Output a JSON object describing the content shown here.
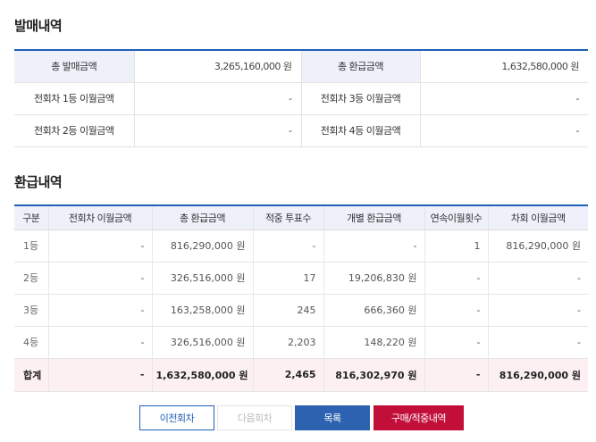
{
  "sales_section": {
    "title": "발매내역",
    "rows": [
      {
        "label1": "총 발매금액",
        "value1": "3,265,160,000 원",
        "label2": "총 환급금액",
        "value2": "1,632,580,000 원"
      },
      {
        "label1": "전회차 1등 이월금액",
        "value1": "-",
        "label2": "전회차 3등 이월금액",
        "value2": "-"
      },
      {
        "label1": "전회차 2등 이월금액",
        "value1": "-",
        "label2": "전회차 4등 이월금액",
        "value2": "-"
      }
    ]
  },
  "refund_section": {
    "title": "환급내역",
    "headers": [
      "구분",
      "전회차 이월금액",
      "총 환급금액",
      "적중 투표수",
      "개별 환급금액",
      "연속이월횟수",
      "차회 이월금액"
    ],
    "rows": [
      [
        "1등",
        "-",
        "816,290,000 원",
        "-",
        "-",
        "1",
        "816,290,000 원"
      ],
      [
        "2등",
        "-",
        "326,516,000 원",
        "17",
        "19,206,830 원",
        "-",
        "-"
      ],
      [
        "3등",
        "-",
        "163,258,000 원",
        "245",
        "666,360 원",
        "-",
        "-"
      ],
      [
        "4등",
        "-",
        "326,516,000 원",
        "2,203",
        "148,220 원",
        "-",
        "-"
      ]
    ],
    "total": [
      "합계",
      "-",
      "1,632,580,000 원",
      "2,465",
      "816,302,970 원",
      "-",
      "816,290,000 원"
    ]
  },
  "buttons": {
    "prev": "이전회차",
    "next": "다음회차",
    "list": "목록",
    "buy": "구매/적중내역"
  }
}
